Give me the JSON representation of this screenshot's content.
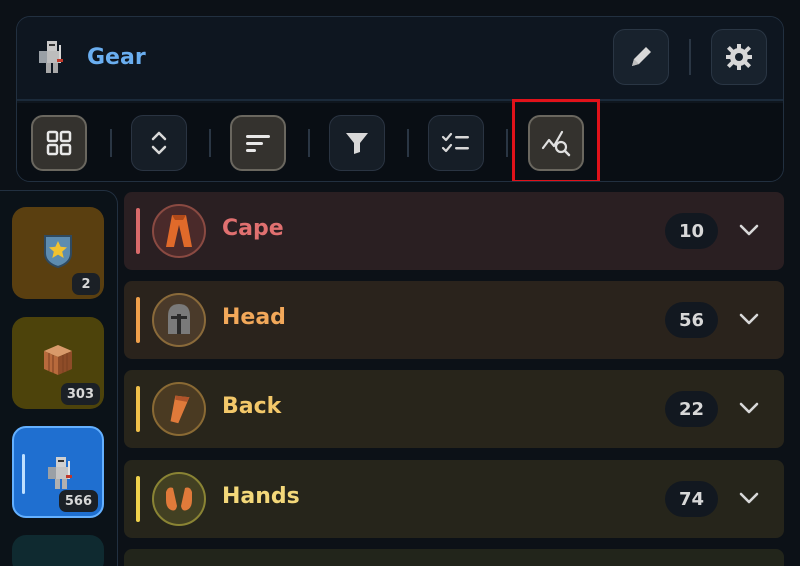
{
  "header": {
    "title": "Gear",
    "edit_icon": "pencil-icon",
    "settings_icon": "gear-icon"
  },
  "toolbar": {
    "buttons": [
      {
        "name": "grid-view",
        "icon": "grid-icon",
        "active": true
      },
      {
        "name": "expand-collapse",
        "icon": "chevron-updown-icon",
        "active": false
      },
      {
        "name": "sort",
        "icon": "sort-lines-icon",
        "active": true
      },
      {
        "name": "filter",
        "icon": "funnel-icon",
        "active": false
      },
      {
        "name": "checklist",
        "icon": "checklist-icon",
        "active": false
      },
      {
        "name": "analyze",
        "icon": "chart-search-icon",
        "active": true,
        "highlighted": true
      }
    ]
  },
  "sidebar": {
    "items": [
      {
        "name": "shield",
        "count": "2",
        "color": "#5a3f10"
      },
      {
        "name": "crate",
        "count": "303",
        "color": "#4d430b"
      },
      {
        "name": "gear",
        "count": "566",
        "color": "#1f6fd0",
        "active": true
      }
    ]
  },
  "categories": [
    {
      "label": "Cape",
      "count": "10",
      "color": "#e07070",
      "accent": "#d96a6a",
      "bg": "#2a1f22"
    },
    {
      "label": "Head",
      "count": "56",
      "color": "#f2a85a",
      "accent": "#f0a04b",
      "bg": "#2a231c"
    },
    {
      "label": "Back",
      "count": "22",
      "color": "#f3c86a",
      "accent": "#f1c04a",
      "bg": "#28251b"
    },
    {
      "label": "Hands",
      "count": "74",
      "color": "#f3d87a",
      "accent": "#f0d24c",
      "bg": "#26251b"
    }
  ]
}
